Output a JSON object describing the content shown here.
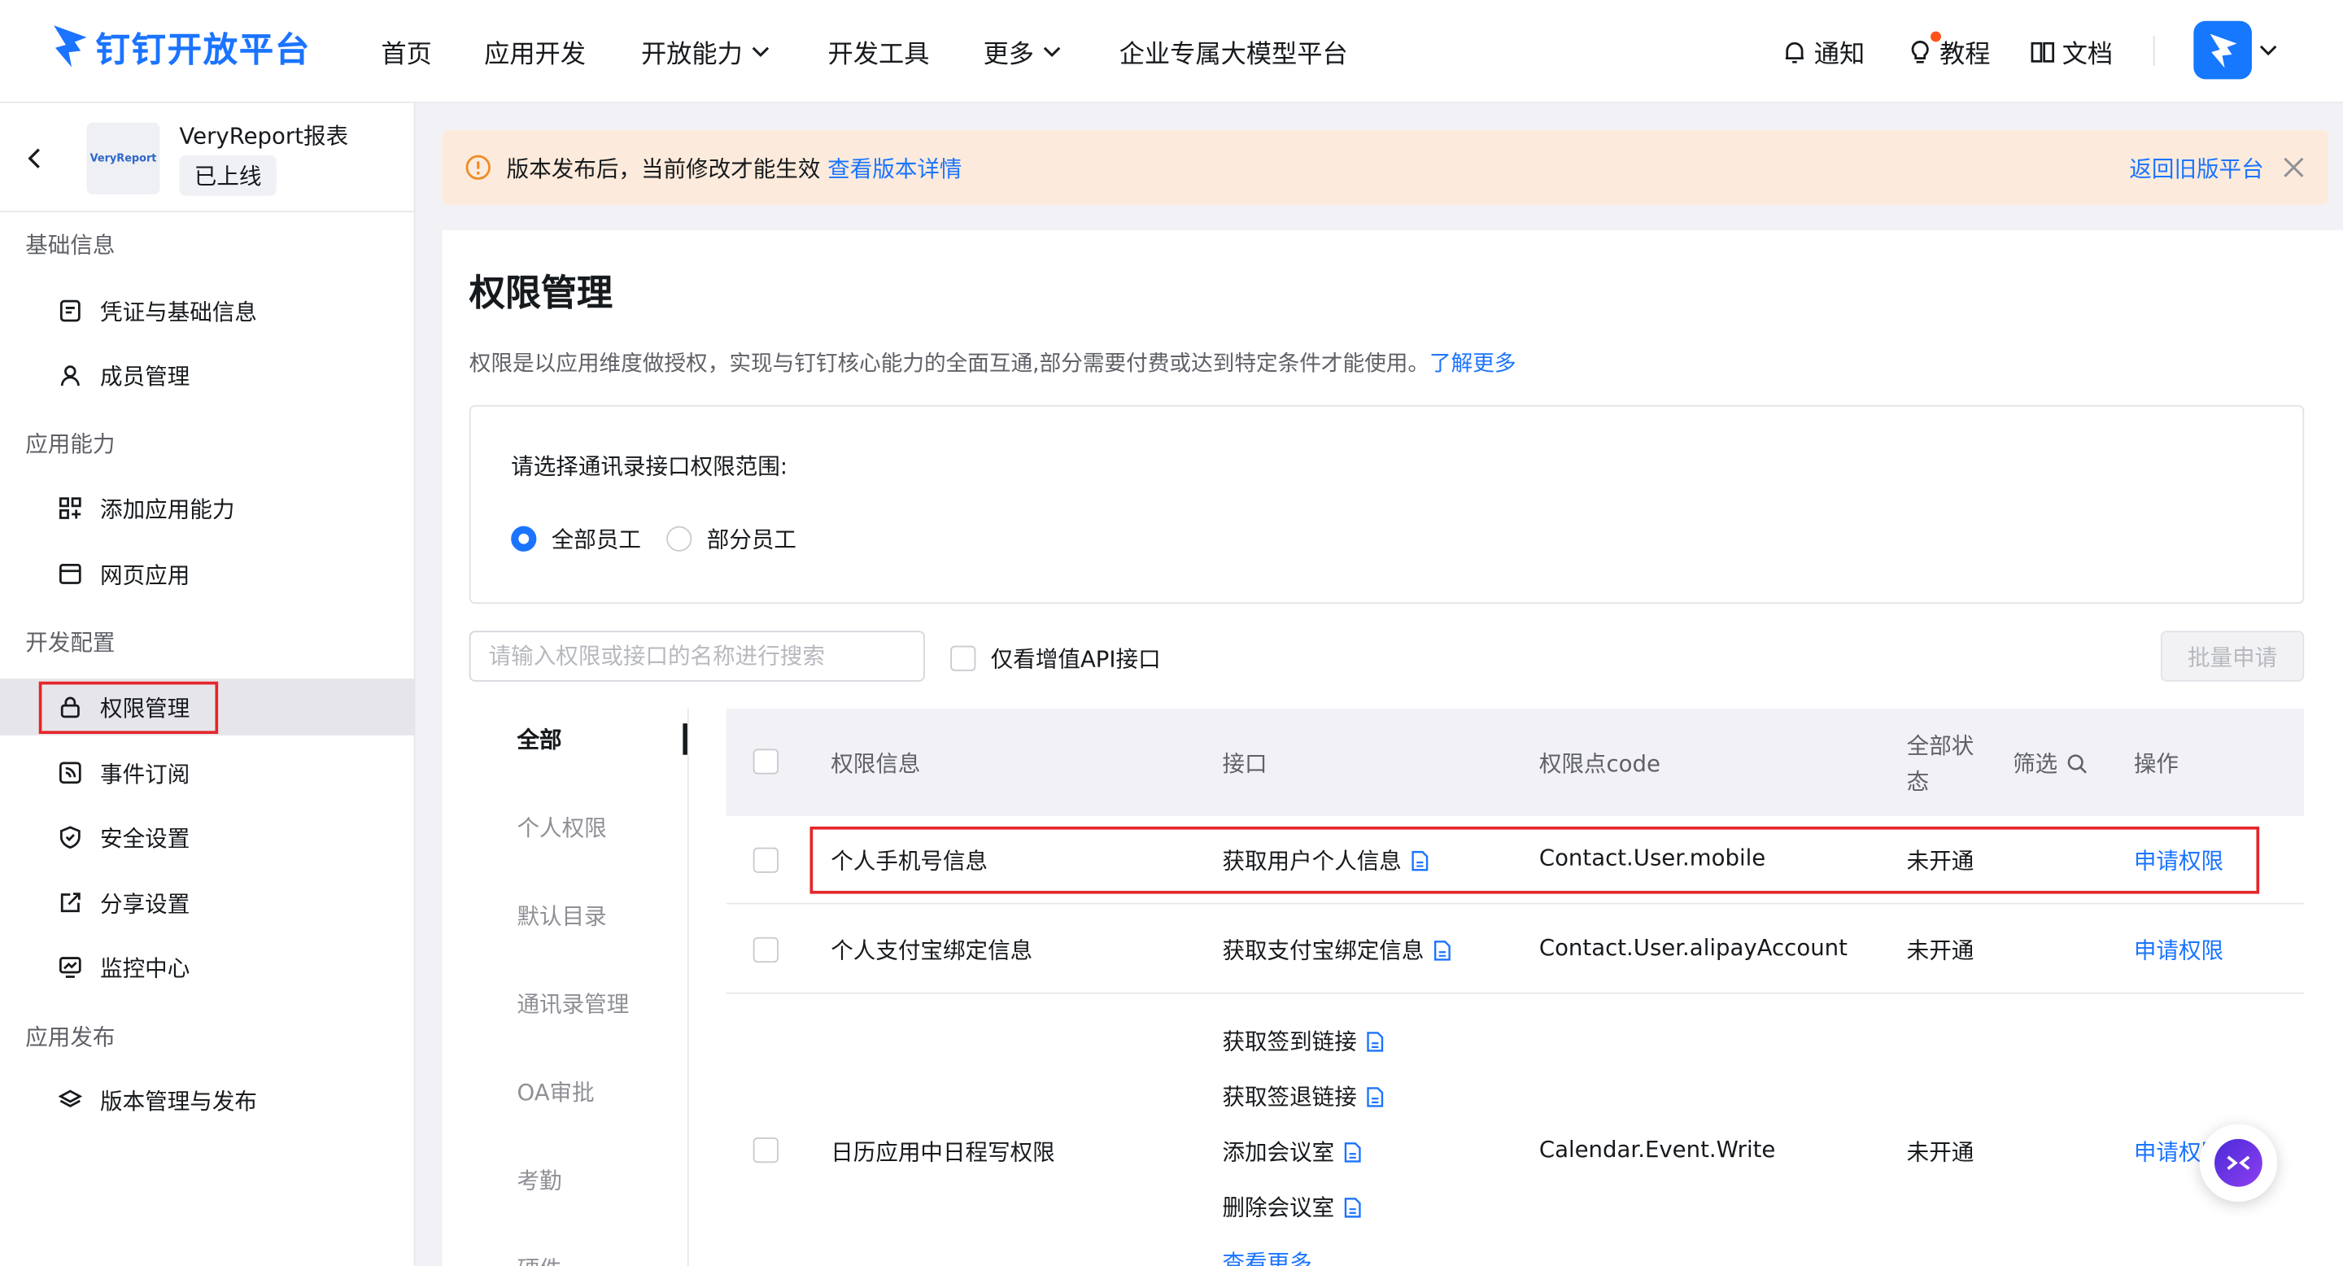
{
  "header": {
    "logo_text": "钉钉开放平台",
    "nav": [
      "首页",
      "应用开发",
      "开放能力",
      "开发工具",
      "更多",
      "企业专属大模型平台"
    ],
    "right": {
      "notify": "通知",
      "tutorial": "教程",
      "docs": "文档"
    }
  },
  "sidebar": {
    "app_name": "VeryReport报表",
    "app_status": "已上线",
    "app_thumb_text": "VeryReport",
    "sections": [
      {
        "title": "基础信息",
        "items": [
          "凭证与基础信息",
          "成员管理"
        ]
      },
      {
        "title": "应用能力",
        "items": [
          "添加应用能力",
          "网页应用"
        ]
      },
      {
        "title": "开发配置",
        "items": [
          "权限管理",
          "事件订阅",
          "安全设置",
          "分享设置",
          "监控中心"
        ]
      },
      {
        "title": "应用发布",
        "items": [
          "版本管理与发布"
        ]
      }
    ],
    "active_item": "权限管理"
  },
  "banner": {
    "text": "版本发布后，当前修改才能生效",
    "link": "查看版本详情",
    "right_link": "返回旧版平台"
  },
  "main": {
    "title": "权限管理",
    "desc": "权限是以应用维度做授权，实现与钉钉核心能力的全面互通,部分需要付费或达到特定条件才能使用。",
    "desc_link": "了解更多",
    "scope": {
      "label": "请选择通讯录接口权限范围:",
      "options": [
        "全部员工",
        "部分员工"
      ],
      "selected": "全部员工"
    },
    "search_placeholder": "请输入权限或接口的名称进行搜索",
    "value_api_only": "仅看增值API接口",
    "batch_button": "批量申请",
    "categories": [
      "全部",
      "个人权限",
      "默认目录",
      "通讯录管理",
      "OA审批",
      "考勤",
      "硬件"
    ],
    "active_category": "全部",
    "table": {
      "headers": {
        "info": "权限信息",
        "api": "接口",
        "code": "权限点code",
        "status_1": "全部状",
        "status_2": "态",
        "filter": "筛选",
        "action": "操作"
      },
      "rows": [
        {
          "info": "个人手机号信息",
          "apis": [
            "获取用户个人信息"
          ],
          "code": "Contact.User.mobile",
          "status": "未开通",
          "action": "申请权限"
        },
        {
          "info": "个人支付宝绑定信息",
          "apis": [
            "获取支付宝绑定信息"
          ],
          "code": "Contact.User.alipayAccount",
          "status": "未开通",
          "action": "申请权限"
        },
        {
          "info": "日历应用中日程写权限",
          "apis": [
            "获取签到链接",
            "获取签退链接",
            "添加会议室",
            "删除会议室"
          ],
          "more": "查看更多",
          "code": "Calendar.Event.Write",
          "status": "未开通",
          "action": "申请权限"
        }
      ]
    }
  },
  "colors": {
    "brand": "#1b74ff",
    "highlight": "#e5262b",
    "banner_bg": "#fcebdc"
  }
}
